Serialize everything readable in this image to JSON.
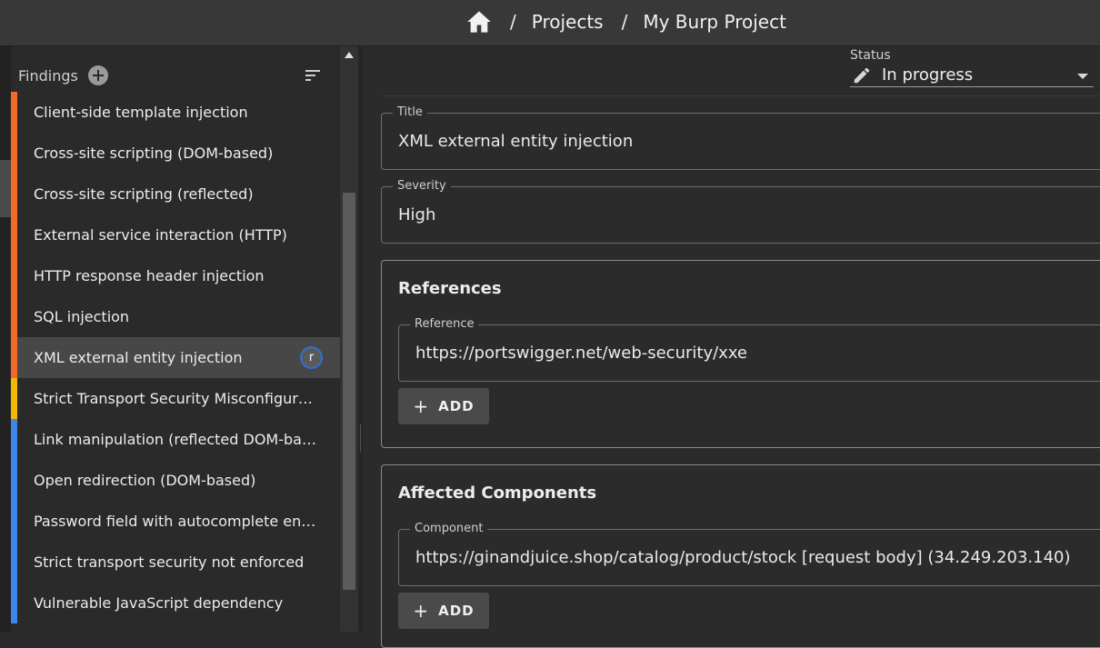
{
  "breadcrumb": {
    "home_icon": "home-icon",
    "separator": "/",
    "items": [
      "Projects",
      "My Burp Project"
    ]
  },
  "sidebar": {
    "title": "Findings",
    "add_icon": "plus-icon",
    "sort_icon": "sort-icon",
    "findings": [
      {
        "label": "Client-side template injection",
        "severity_color": "#f26a2c"
      },
      {
        "label": "Cross-site scripting (DOM-based)",
        "severity_color": "#f26a2c"
      },
      {
        "label": "Cross-site scripting (reflected)",
        "severity_color": "#f26a2c"
      },
      {
        "label": "External service interaction (HTTP)",
        "severity_color": "#f26a2c"
      },
      {
        "label": "HTTP response header injection",
        "severity_color": "#f26a2c"
      },
      {
        "label": "SQL injection",
        "severity_color": "#f26a2c"
      },
      {
        "label": "XML external entity injection",
        "severity_color": "#f26a2c",
        "selected": true,
        "avatar": "r"
      },
      {
        "label": "Strict Transport Security Misconfiguration",
        "severity_color": "#f2b705"
      },
      {
        "label": "Link manipulation (reflected DOM-based)",
        "severity_color": "#3f86e8"
      },
      {
        "label": "Open redirection (DOM-based)",
        "severity_color": "#3f86e8"
      },
      {
        "label": "Password field with autocomplete enabled",
        "severity_color": "#3f86e8"
      },
      {
        "label": "Strict transport security not enforced",
        "severity_color": "#3f86e8"
      },
      {
        "label": "Vulnerable JavaScript dependency",
        "severity_color": "#3f86e8"
      }
    ]
  },
  "status": {
    "label": "Status",
    "value": "In progress"
  },
  "title_field": {
    "label": "Title",
    "value": "XML external entity injection"
  },
  "severity_field": {
    "label": "Severity",
    "value": "High"
  },
  "references": {
    "heading": "References",
    "field_label": "Reference",
    "value": "https://portswigger.net/web-security/xxe",
    "add_label": "ADD"
  },
  "components": {
    "heading": "Affected Components",
    "field_label": "Component",
    "value": "https://ginandjuice.shop/catalog/product/stock [request body] (34.249.203.140)",
    "add_label": "ADD"
  },
  "colors": {
    "high": "#f26a2c",
    "medium": "#f2b705",
    "low": "#3f86e8",
    "accent": "#2f6fd6"
  }
}
